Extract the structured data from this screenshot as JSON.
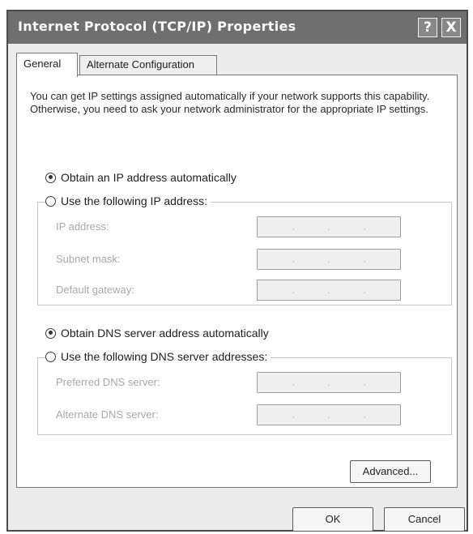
{
  "window": {
    "title": "Internet Protocol (TCP/IP) Properties",
    "help_label": "?",
    "close_label": "X"
  },
  "tabs": [
    {
      "label": "General",
      "selected": true
    },
    {
      "label": "Alternate Configuration",
      "selected": false
    }
  ],
  "intro_text": "You can get IP settings assigned automatically if your network supports this capability. Otherwise, you need to ask your network administrator for the appropriate IP settings.",
  "ip": {
    "auto_label": "Obtain an IP address automatically",
    "manual_label": "Use the following IP address:",
    "selected": "auto",
    "fields": [
      {
        "label": "IP address:",
        "value": ""
      },
      {
        "label": "Subnet mask:",
        "value": ""
      },
      {
        "label": "Default gateway:",
        "value": ""
      }
    ]
  },
  "dns": {
    "auto_label": "Obtain DNS server address automatically",
    "manual_label": "Use the following DNS server addresses:",
    "selected": "auto",
    "fields": [
      {
        "label": "Preferred DNS server:",
        "value": ""
      },
      {
        "label": "Alternate DNS server:",
        "value": ""
      }
    ]
  },
  "buttons": {
    "advanced": "Advanced...",
    "ok": "OK",
    "cancel": "Cancel"
  }
}
